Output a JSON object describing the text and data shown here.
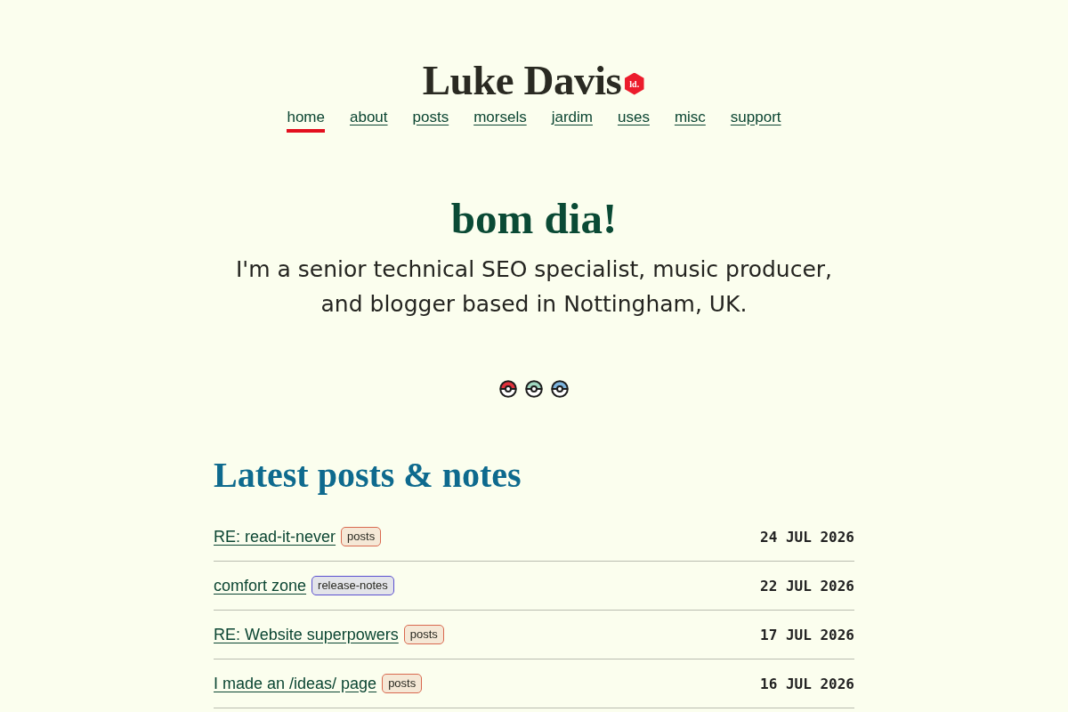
{
  "site": {
    "title": "Luke Davis",
    "logo_badge": "ld."
  },
  "nav": [
    {
      "label": "home",
      "selected": true
    },
    {
      "label": "about",
      "selected": false
    },
    {
      "label": "posts",
      "selected": false
    },
    {
      "label": "morsels",
      "selected": false
    },
    {
      "label": "jardim",
      "selected": false
    },
    {
      "label": "uses",
      "selected": false
    },
    {
      "label": "misc",
      "selected": false
    },
    {
      "label": "support",
      "selected": false
    }
  ],
  "hero": {
    "greeting": "bom dia!",
    "intro": "I'm a senior technical SEO specialist, music producer, and blogger based in Nottingham, UK."
  },
  "themes": [
    {
      "color": "#e0313b"
    },
    {
      "color": "#9fd6bf"
    },
    {
      "color": "#7db4dd"
    }
  ],
  "latest": {
    "heading": "Latest posts & notes",
    "posts": [
      {
        "title": "RE: read-it-never",
        "tag": {
          "label": "posts",
          "color": "#d9694f"
        },
        "date": "24 JUL 2026"
      },
      {
        "title": "comfort zone",
        "tag": {
          "label": "release-notes",
          "color": "#5b50d0"
        },
        "date": "22 JUL 2026"
      },
      {
        "title": "RE: Website superpowers",
        "tag": {
          "label": "posts",
          "color": "#d9694f"
        },
        "date": "17 JUL 2026"
      },
      {
        "title": "I made an /ideas/ page",
        "tag": {
          "label": "posts",
          "color": "#d9694f"
        },
        "date": "16 JUL 2026"
      }
    ]
  }
}
